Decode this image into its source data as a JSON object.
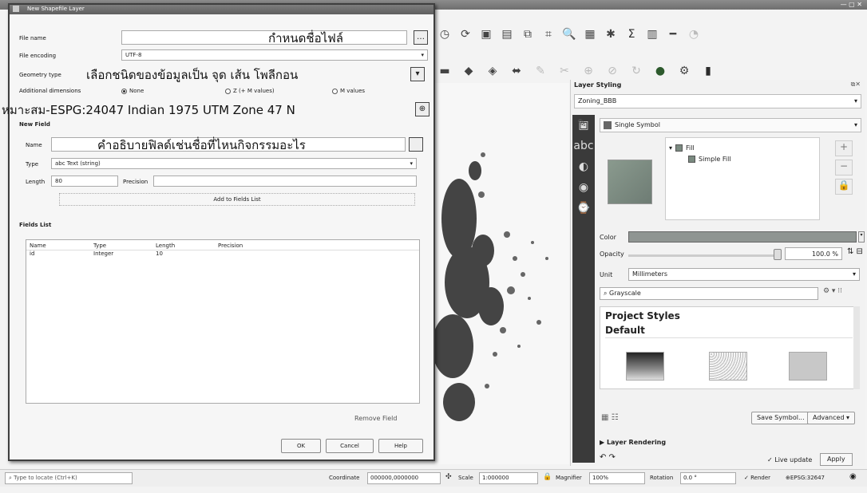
{
  "dialog": {
    "title": "New Shapefile Layer",
    "file_name_label": "File name",
    "file_name_annotation": "กำหนดชื่อไฟล์",
    "file_encoding_label": "File encoding",
    "file_encoding_value": "UTF-8",
    "geometry_type_label": "Geometry type",
    "geometry_annotation": "เลือกชนิดของข้อมูลเป็น จุด เส้น โพลีกอน",
    "additional_dims_label": "Additional dimensions",
    "dim_options": [
      "None",
      "Z (+ M values)",
      "M values"
    ],
    "crs_annotation": "หมาะสม-ESPG:24047 Indian 1975 UTM Zone 47 N",
    "new_field_section": "New Field",
    "name_label": "Name",
    "name_annotation": "คำอธิบายฟิลด์เช่นชื่อที่ไหนกิจกรรมอะไร",
    "type_label": "Type",
    "type_value": "abc Text (string)",
    "length_label": "Length",
    "length_value": "80",
    "precision_label": "Precision",
    "add_to_fields_label": "Add to Fields List",
    "fields_list_section": "Fields List",
    "table_headers": [
      "Name",
      "Type",
      "Length",
      "Precision"
    ],
    "table_rows": [
      {
        "name": "id",
        "type": "Integer",
        "length": "10",
        "precision": ""
      }
    ],
    "remove_field_label": "Remove Field",
    "ok_label": "OK",
    "cancel_label": "Cancel",
    "help_label": "Help"
  },
  "dock": {
    "title": "Layer Styling",
    "layer_name": "Zoning_BBB",
    "renderer": "Single Symbol",
    "tree_fill": "Fill",
    "tree_simple_fill": "Simple Fill",
    "color_label": "Color",
    "color_value": "#8f9592",
    "opacity_label": "Opacity",
    "opacity_value": "100.0 %",
    "unit_label": "Unit",
    "unit_value": "Millimeters",
    "search_placeholder": "Grayscale",
    "project_styles": "Project Styles",
    "default_label": "Default",
    "save_symbol_label": "Save Symbol...",
    "advanced_label": "Advanced",
    "layer_rendering_label": "Layer Rendering",
    "live_update_label": "✓ Live update",
    "apply_label": "Apply"
  },
  "status_bar": {
    "locator_placeholder": "Type to locate (Ctrl+K)",
    "coordinate_label": "Coordinate",
    "coordinate_value": "000000,0000000",
    "scale_label": "Scale",
    "scale_value": "1:000000",
    "magnifier_label": "Magnifier",
    "magnifier_value": "100%",
    "rotation_label": "Rotation",
    "rotation_value": "0.0 °",
    "render_label": "Render",
    "crs_value": "EPSG:32647"
  }
}
